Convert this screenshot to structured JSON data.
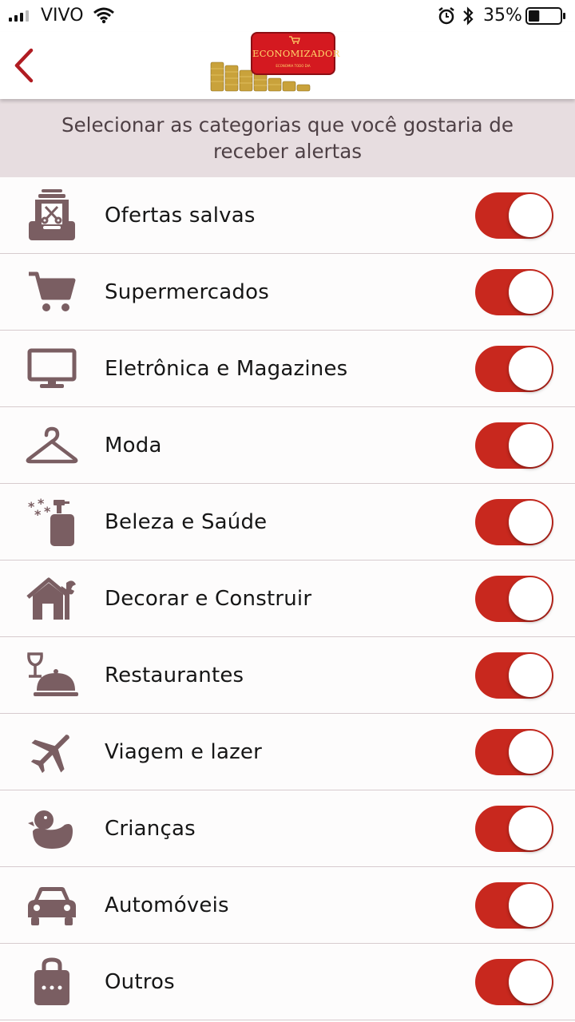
{
  "status_bar": {
    "carrier": "VIVO",
    "battery_percent": "35%",
    "battery_level": 0.35,
    "icons": [
      "signal-icon",
      "wifi-icon",
      "alarm-icon",
      "bluetooth-icon",
      "battery-icon"
    ]
  },
  "header": {
    "back_icon": "chevron-left-icon",
    "logo_text": "ECONOMIZADOR",
    "logo_subtext": "ECONOMIA TODO DIA"
  },
  "banner": {
    "text": "Selecionar as categorias que você gostaria de receber alertas"
  },
  "colors": {
    "accent": "#c8281e",
    "icon": "#7a5e62",
    "banner_bg": "#e7dde0",
    "back_arrow": "#b01c22"
  },
  "categories": [
    {
      "label": "Ofertas salvas",
      "icon": "saved-coupons-icon",
      "enabled": true
    },
    {
      "label": "Supermercados",
      "icon": "shopping-cart-icon",
      "enabled": true
    },
    {
      "label": "Eletrônica e Magazines",
      "icon": "monitor-icon",
      "enabled": true
    },
    {
      "label": "Moda",
      "icon": "hanger-icon",
      "enabled": true
    },
    {
      "label": "Beleza e Saúde",
      "icon": "spray-bottle-icon",
      "enabled": true
    },
    {
      "label": "Decorar e Construir",
      "icon": "house-tools-icon",
      "enabled": true
    },
    {
      "label": "Restaurantes",
      "icon": "restaurant-icon",
      "enabled": true
    },
    {
      "label": "Viagem e lazer",
      "icon": "airplane-icon",
      "enabled": true
    },
    {
      "label": "Crianças",
      "icon": "rubber-duck-icon",
      "enabled": true
    },
    {
      "label": "Automóveis",
      "icon": "car-icon",
      "enabled": true
    },
    {
      "label": "Outros",
      "icon": "shopping-bag-icon",
      "enabled": true
    }
  ]
}
